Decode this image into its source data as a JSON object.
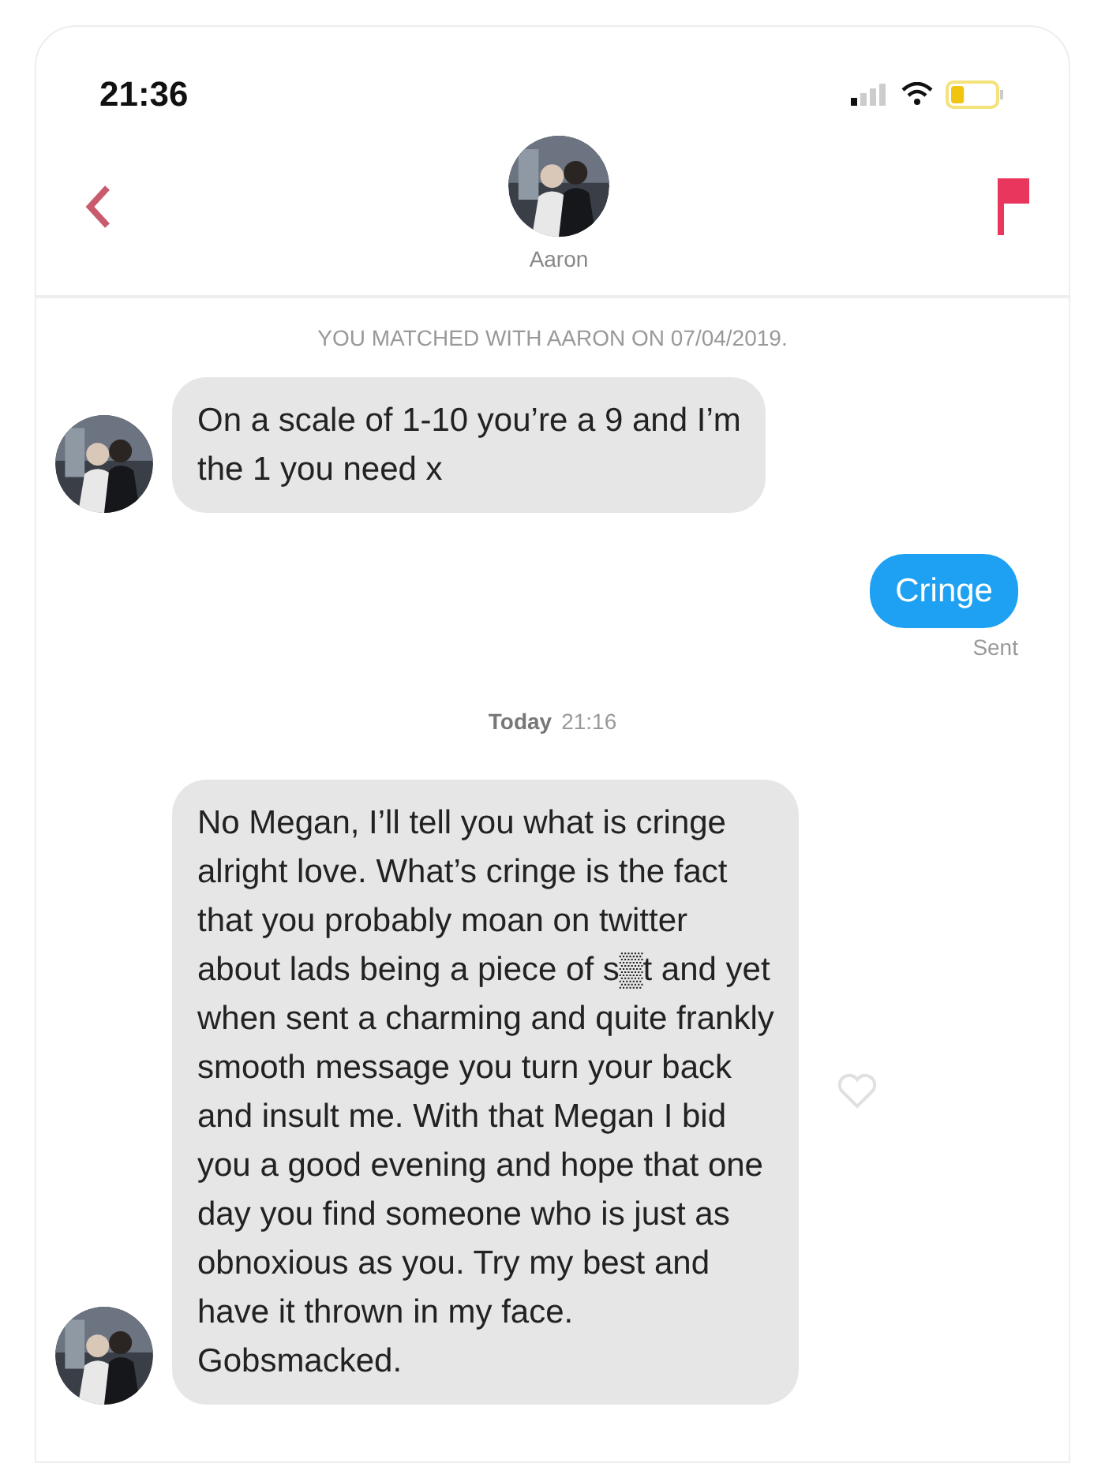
{
  "status_bar": {
    "time": "21:36"
  },
  "header": {
    "name": "Aaron"
  },
  "match_notice": "YOU MATCHED WITH AARON ON 07/04/2019.",
  "messages": [
    {
      "kind": "received",
      "text": "On a scale of 1-10 you’re a 9 and I’m\nthe 1 you need x",
      "heart": false
    },
    {
      "kind": "sent",
      "text": "Cringe",
      "status": "Sent"
    },
    {
      "kind": "date",
      "day": "Today",
      "time": "21:16"
    },
    {
      "kind": "received",
      "text": "No Megan, I’ll tell you what is cringe\nalright love.  What’s cringe is the fact\nthat you probably moan on twitter\nabout lads being a piece of s▒t and yet\nwhen sent a charming and quite frankly\nsmooth message you turn your back\nand insult me. With that Megan I bid\nyou a good evening and hope that one\nday you find someone who is just as\nobnoxious as you. Try my best and\nhave it thrown in my face.\nGobsmacked.",
      "heart": true
    }
  ]
}
